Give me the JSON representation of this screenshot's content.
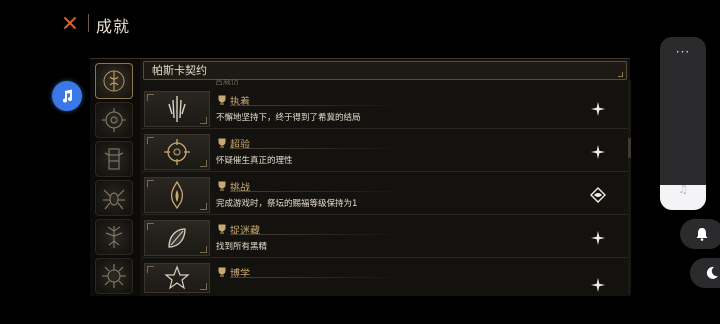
{
  "header": {
    "title": "成就",
    "close_icon": "close-x-icon"
  },
  "music_button": {
    "icon": "music-note-icon",
    "color": "#3a78e8"
  },
  "search": {
    "value": "帕斯卡契约"
  },
  "clipped_text": "吕威仿",
  "categories": [
    {
      "icon": "compass-rune-icon",
      "active": true
    },
    {
      "icon": "sun-circle-icon",
      "active": false
    },
    {
      "icon": "totem-icon",
      "active": false
    },
    {
      "icon": "spider-sigil-icon",
      "active": false
    },
    {
      "icon": "tree-sigil-icon",
      "active": false
    },
    {
      "icon": "sun-sigil-icon",
      "active": false
    }
  ],
  "achievements": [
    {
      "name": "执着",
      "description": "不懈地坚持下，终于得到了希冀的结局",
      "status_icon": "sparkle-icon"
    },
    {
      "name": "超验",
      "description": "怀疑催生真正的理性",
      "status_icon": "sparkle-icon"
    },
    {
      "name": "挑战",
      "description": "完成游戏时，祭坛的赐福等级保持为1",
      "status_icon": "eye-sigil-icon"
    },
    {
      "name": "捉迷藏",
      "description": "找到所有黑精",
      "status_icon": "sparkle-icon"
    },
    {
      "name": "博学",
      "description": "",
      "status_icon": "sparkle-icon"
    }
  ],
  "side_controls": {
    "menu": "···",
    "music_icon": "♫",
    "bell_icon": "bell-icon",
    "moon_icon": "moon-icon"
  },
  "colors": {
    "accent_orange": "#e0642a",
    "gold": "#c9a970",
    "panel_bg": "#14120f"
  }
}
